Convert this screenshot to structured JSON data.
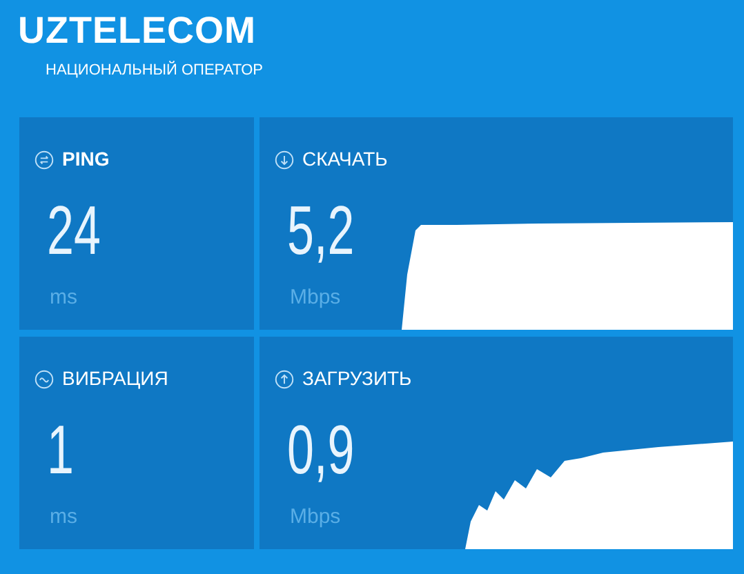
{
  "brand": {
    "logo": "UZTELECOM",
    "tagline": "НАЦИОНАЛЬНЫЙ ОПЕРАТОР"
  },
  "metrics": [
    {
      "kind": "ping",
      "label": "PING",
      "value": "24",
      "unit": "ms"
    },
    {
      "kind": "download",
      "label": "СКАЧАТЬ",
      "value": "5,2",
      "unit": "Mbps"
    },
    {
      "kind": "jitter",
      "label": "ВИБРАЦИЯ",
      "value": "1",
      "unit": "ms"
    },
    {
      "kind": "upload",
      "label": "ЗАГРУЗИТЬ",
      "value": "0,9",
      "unit": "Mbps"
    }
  ]
}
